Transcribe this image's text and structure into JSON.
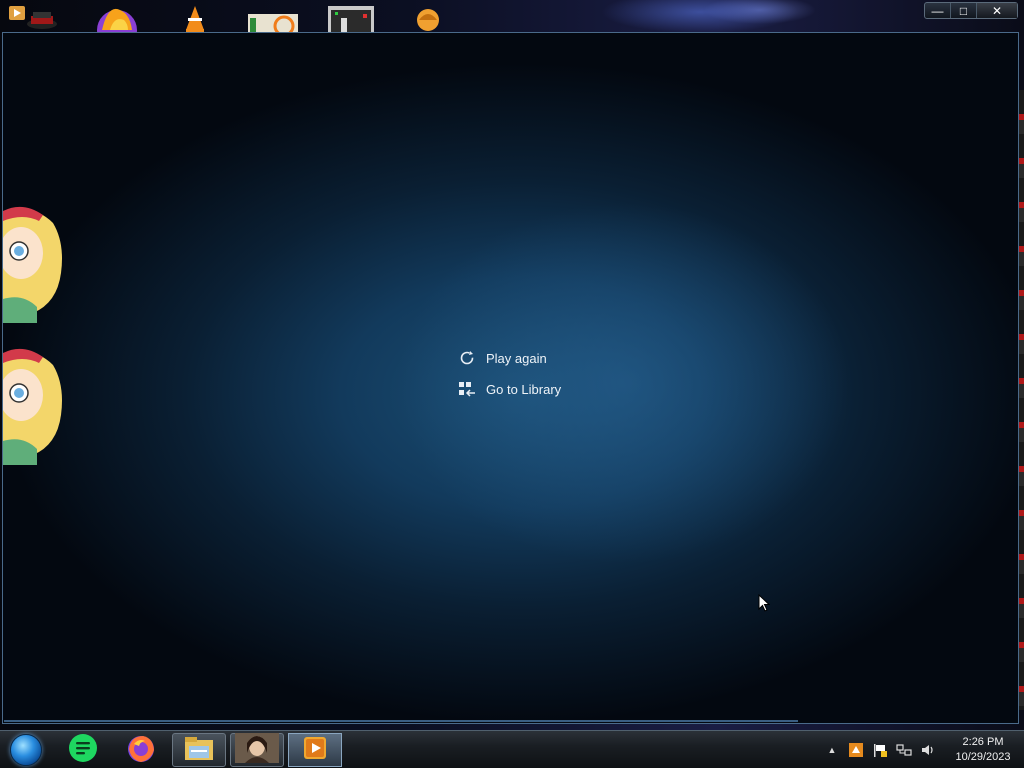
{
  "desktop": {
    "top_icons": [
      "media-player-small-icon",
      "hat-icon",
      "firefox-dev-icon",
      "vlc-icon",
      "bayd-icon",
      "terminal-icon",
      "orange-avatar-icon"
    ]
  },
  "window": {
    "controls": {
      "minimize": "—",
      "maximize": "□",
      "close": "✕"
    }
  },
  "end_menu": {
    "items": [
      {
        "label": "Play again",
        "icon": "replay-icon"
      },
      {
        "label": "Go to Library",
        "icon": "library-icon"
      }
    ]
  },
  "taskbar": {
    "apps": [
      "spotify-icon",
      "firefox-icon",
      "file-explorer-icon",
      "portrait-app-icon",
      "media-player-icon"
    ],
    "active_app": "media-player-icon",
    "tray": {
      "overflow": "▲",
      "icons": [
        "tray-app-icon",
        "action-center-flag-icon",
        "network-icon",
        "volume-icon"
      ]
    },
    "clock": {
      "time": "2:26 PM",
      "date": "10/29/2023"
    }
  },
  "colors": {
    "accent": "#1b4e74",
    "spotify": "#1ed760",
    "start_orb": "#2a8ee0"
  }
}
